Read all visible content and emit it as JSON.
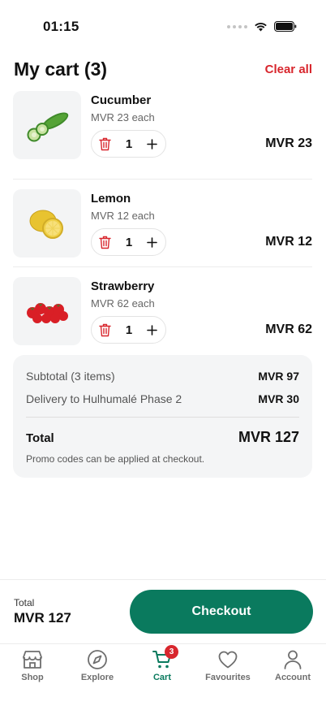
{
  "status_bar": {
    "time": "01:15"
  },
  "header": {
    "title": "My cart (3)",
    "clear_label": "Clear all"
  },
  "cart": {
    "items": [
      {
        "name": "Cucumber",
        "unit_price": "MVR 23 each",
        "quantity": "1",
        "price": "MVR 23",
        "image": "cucumber"
      },
      {
        "name": "Lemon",
        "unit_price": "MVR 12 each",
        "quantity": "1",
        "price": "MVR 12",
        "image": "lemon"
      },
      {
        "name": "Strawberry",
        "unit_price": "MVR 62 each",
        "quantity": "1",
        "price": "MVR 62",
        "image": "strawberry"
      }
    ]
  },
  "summary": {
    "subtotal_label": "Subtotal (3 items)",
    "subtotal_value": "MVR 97",
    "delivery_label": "Delivery to Hulhumalé Phase 2",
    "delivery_value": "MVR 30",
    "total_label": "Total",
    "total_value": "MVR 127",
    "promo_note": "Promo codes can be applied at checkout."
  },
  "checkout_bar": {
    "total_label": "Total",
    "total_value": "MVR 127",
    "button_label": "Checkout"
  },
  "tabs": [
    {
      "label": "Shop",
      "icon": "store-icon",
      "active": false
    },
    {
      "label": "Explore",
      "icon": "compass-icon",
      "active": false
    },
    {
      "label": "Cart",
      "icon": "cart-icon",
      "active": true,
      "badge": "3"
    },
    {
      "label": "Favourites",
      "icon": "heart-icon",
      "active": false
    },
    {
      "label": "Account",
      "icon": "person-icon",
      "active": false
    }
  ],
  "colors": {
    "accent": "#0a7a5e",
    "danger": "#d8262d",
    "card_bg": "#f4f5f6"
  }
}
